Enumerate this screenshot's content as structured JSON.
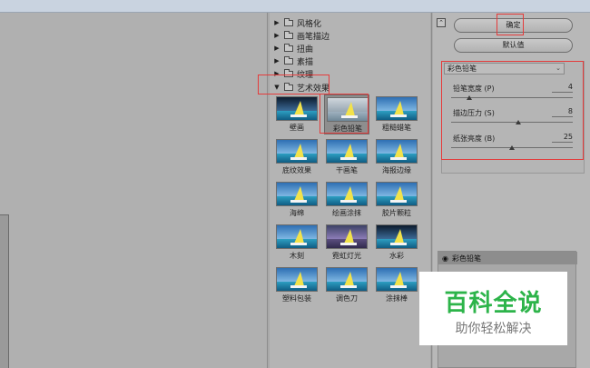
{
  "gallery": {
    "categories": [
      {
        "label": "风格化",
        "expanded": false
      },
      {
        "label": "画笔描边",
        "expanded": false
      },
      {
        "label": "扭曲",
        "expanded": false
      },
      {
        "label": "素描",
        "expanded": false
      },
      {
        "label": "纹理",
        "expanded": false
      },
      {
        "label": "艺术效果",
        "expanded": true
      }
    ],
    "filters": [
      {
        "label": "壁画",
        "style": "dark"
      },
      {
        "label": "彩色铅笔",
        "style": "sketch",
        "selected": true
      },
      {
        "label": "粗糙蜡笔",
        "style": "normal"
      },
      {
        "label": "底纹效果",
        "style": "normal"
      },
      {
        "label": "干画笔",
        "style": "normal"
      },
      {
        "label": "海报边缘",
        "style": "normal"
      },
      {
        "label": "海绵",
        "style": "normal"
      },
      {
        "label": "绘画涂抹",
        "style": "normal"
      },
      {
        "label": "胶片颗粒",
        "style": "normal"
      },
      {
        "label": "木刻",
        "style": "normal"
      },
      {
        "label": "霓虹灯光",
        "style": "neon"
      },
      {
        "label": "水彩",
        "style": "dark"
      },
      {
        "label": "塑料包装",
        "style": "normal"
      },
      {
        "label": "调色刀",
        "style": "normal"
      },
      {
        "label": "涂抹棒",
        "style": "normal"
      }
    ]
  },
  "settings": {
    "collapse_glyph": "⌃",
    "ok_label": "确定",
    "default_label": "默认值",
    "selected_filter": "彩色铅笔",
    "params": [
      {
        "label": "铅笔宽度 (P)",
        "value": "4",
        "fraction": 0.15
      },
      {
        "label": "描边压力 (S)",
        "value": "8",
        "fraction": 0.55
      },
      {
        "label": "纸张亮度 (B)",
        "value": "25",
        "fraction": 0.5
      }
    ],
    "layer_label": "彩色铅笔"
  },
  "watermark": {
    "main": "百科全说",
    "sub": "助你轻松解决"
  },
  "colors": {
    "highlight": "#e43b3b",
    "watermark_green": "#2db44a"
  }
}
